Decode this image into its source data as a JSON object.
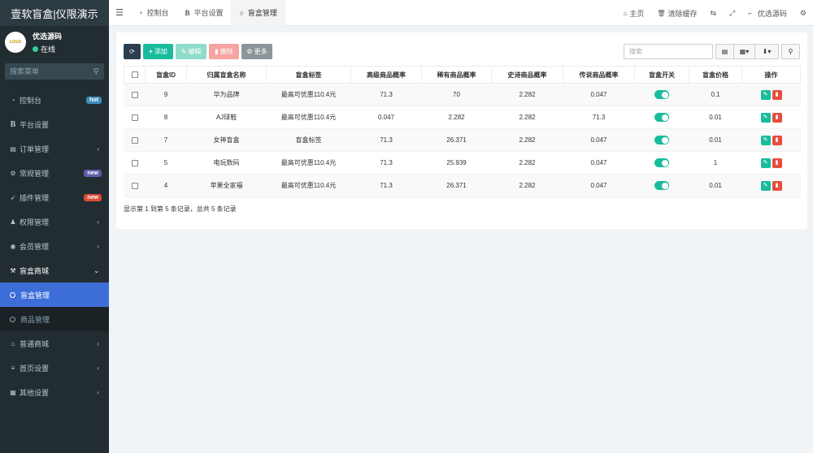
{
  "app": {
    "title": "壹软盲盒|仪限演示"
  },
  "user": {
    "avatar_text": "LOGO",
    "name": "优选源码",
    "status": "在线"
  },
  "sidebar": {
    "search_placeholder": "搜索菜单",
    "items": [
      {
        "label": "控制台",
        "icon": "dashboard-icon",
        "badge": "hot",
        "badge_color": "#3c8dbc"
      },
      {
        "label": "平台设置",
        "icon": "bold-b-icon"
      },
      {
        "label": "订单管理",
        "icon": "order-icon",
        "chevron": "‹"
      },
      {
        "label": "常规管理",
        "icon": "cogs-icon",
        "badge": "new",
        "badge_color": "#605ca8"
      },
      {
        "label": "插件管理",
        "icon": "rocket-icon",
        "badge": "new",
        "badge_color": "#dd4b39"
      },
      {
        "label": "权限管理",
        "icon": "group-icon",
        "chevron": "‹"
      },
      {
        "label": "会员管理",
        "icon": "user-circle-icon",
        "chevron": "‹"
      },
      {
        "label": "盲盒商城",
        "icon": "gavel-icon",
        "chevron": "⌄"
      }
    ],
    "subitems": [
      {
        "label": "盲盒管理",
        "active": true
      },
      {
        "label": "商品管理",
        "active": false
      }
    ],
    "items_after": [
      {
        "label": "普通商城",
        "icon": "bank-icon",
        "chevron": "‹"
      },
      {
        "label": "首页设置",
        "icon": "list-icon",
        "chevron": "‹"
      },
      {
        "label": "其他设置",
        "icon": "database-icon",
        "chevron": "‹"
      }
    ]
  },
  "topbar": {
    "tabs": [
      {
        "label": "控制台",
        "icon": "dashboard-icon"
      },
      {
        "label": "平台设置",
        "icon": "bold-b-icon"
      },
      {
        "label": "盲盒管理",
        "icon": "circle-icon",
        "active": true
      }
    ],
    "right": {
      "home": "主页",
      "clear_cache": "清除缓存",
      "username": "优选源码"
    }
  },
  "toolbar": {
    "add": "添加",
    "edit": "编辑",
    "delete": "删除",
    "more": "更多",
    "search_placeholder": "搜索"
  },
  "table": {
    "headers": [
      "盲盒ID",
      "归属盲盒名称",
      "盲盒标签",
      "高级商品概率",
      "稀有商品概率",
      "史诗商品概率",
      "传说商品概率",
      "盲盒开关",
      "盲盒价格",
      "操作"
    ],
    "rows": [
      {
        "id": "9",
        "name": "华为品牌",
        "tag": "最高可优惠110.4元",
        "p1": "71.3",
        "p2": "70",
        "p3": "2.282",
        "p4": "0.047",
        "price": "0.1"
      },
      {
        "id": "8",
        "name": "AJ球鞋",
        "tag": "最高可优惠110.4元",
        "p1": "0.047",
        "p2": "2.282",
        "p3": "2.282",
        "p4": "71.3",
        "price": "0.01"
      },
      {
        "id": "7",
        "name": "女神盲盒",
        "tag": "盲盒标签",
        "p1": "71.3",
        "p2": "26.371",
        "p3": "2.282",
        "p4": "0.047",
        "price": "0.01"
      },
      {
        "id": "5",
        "name": "电玩数码",
        "tag": "最高可优惠110.4元",
        "p1": "71.3",
        "p2": "25.939",
        "p3": "2.282",
        "p4": "0.047",
        "price": "1"
      },
      {
        "id": "4",
        "name": "苹果全家福",
        "tag": "最高可优惠110.4元",
        "p1": "71.3",
        "p2": "26.371",
        "p3": "2.282",
        "p4": "0.047",
        "price": "0.01"
      }
    ]
  },
  "footer": {
    "text": "显示第 1 到第 5 条记录，总共 5 条记录"
  }
}
